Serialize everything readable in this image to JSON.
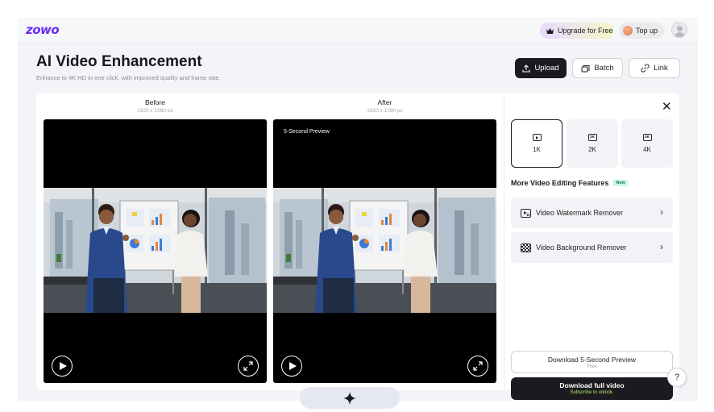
{
  "app": {
    "logo_text": "zowo",
    "brand_color": "#6a2cf5"
  },
  "topbar": {
    "upgrade_label": "Upgrade for Free",
    "topup_label": "Top up"
  },
  "header": {
    "title": "AI Video Enhancement",
    "subtitle": "Enhance to 4K HD in one click, with improved quality and frame rate.",
    "upload_label": "Upload",
    "batch_label": "Batch",
    "link_label": "Link"
  },
  "before": {
    "title": "Before",
    "resolution": "1920 x 1080 px"
  },
  "after": {
    "title": "After",
    "resolution": "1920 x 1080 px",
    "preview_tag": "5-Second Preview"
  },
  "resolutions": [
    {
      "label": "1K",
      "icon": "play-icon",
      "selected": true
    },
    {
      "label": "2K",
      "icon": "2k-icon",
      "badge": "2K",
      "selected": false
    },
    {
      "label": "4K",
      "icon": "4k-icon",
      "badge": "4K",
      "selected": false
    }
  ],
  "more_features": {
    "title": "More Video Editing Features",
    "badge": "New",
    "items": [
      {
        "label": "Video Watermark Remover"
      },
      {
        "label": "Video Background Remover"
      }
    ]
  },
  "downloads": {
    "preview_label": "Download 5-Second Preview",
    "preview_note": "Free",
    "full_label": "Download full video",
    "full_note": "Subscribe to unlock."
  },
  "help_label": "?"
}
